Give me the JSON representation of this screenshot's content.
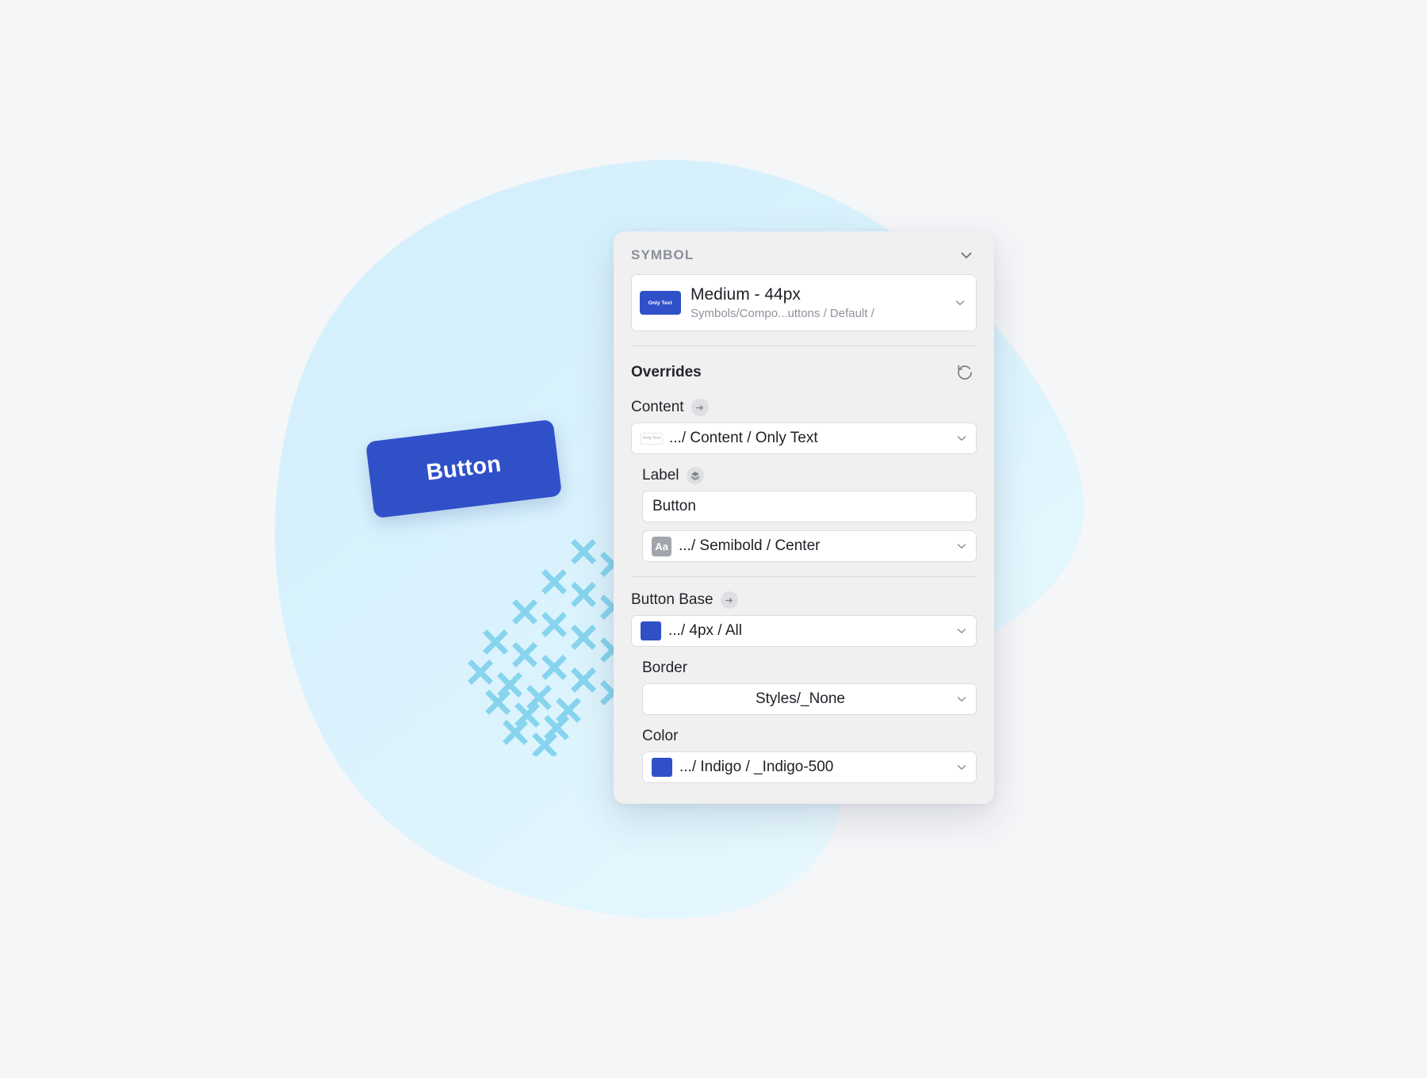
{
  "palette": {
    "background": "#f5f6f8",
    "blob": "#d4f0fb",
    "blob_light": "#e6f7fd",
    "indigo": "#3050c8",
    "cross": "#87d4ee",
    "panel": "#f0f0f1",
    "field_border": "#dcdde0",
    "text_primary": "#1d2026",
    "text_muted": "#8d929b"
  },
  "artboard": {
    "demo_button": {
      "label": "Button",
      "rotation_deg": -7,
      "fill": "#3050c8"
    },
    "cross_pattern": {
      "icon": "x-cross-icon",
      "color": "#87d4ee",
      "rows": 9,
      "columns": 5
    }
  },
  "panel": {
    "header": {
      "title": "SYMBOL",
      "collapse_icon": "chevron-down-icon"
    },
    "symbol": {
      "thumbnail_text": "Only Text",
      "name": "Medium - 44px",
      "path": "Symbols/Compo...uttons / Default /",
      "caret_icon": "chevron-down-icon"
    },
    "overrides": {
      "title": "Overrides",
      "reset_icon": "reset-arrow-icon",
      "groups": [
        {
          "label": "Content",
          "label_icon": "arrow-right-icon",
          "select": {
            "thumbnail_text": "Only Text",
            "value": ".../ Content / Only Text",
            "caret_icon": "chevron-down-icon"
          },
          "children": [
            {
              "label": "Label",
              "label_icon": "layers-icon",
              "input": {
                "value": "Button",
                "placeholder": "Button"
              },
              "select": {
                "chip": "Aa",
                "value": ".../ Semibold / Center",
                "caret_icon": "chevron-down-icon"
              }
            }
          ]
        },
        {
          "label": "Button Base",
          "label_icon": "arrow-right-icon",
          "select": {
            "swatch": "#3050c8",
            "value": ".../ 4px / All",
            "caret_icon": "chevron-down-icon"
          },
          "children": [
            {
              "label": "Border",
              "select": {
                "value": "Styles/_None",
                "caret_icon": "chevron-down-icon"
              }
            },
            {
              "label": "Color",
              "select": {
                "swatch": "#3050c8",
                "value": ".../ Indigo / _Indigo-500",
                "caret_icon": "chevron-down-icon"
              }
            }
          ]
        }
      ]
    }
  }
}
